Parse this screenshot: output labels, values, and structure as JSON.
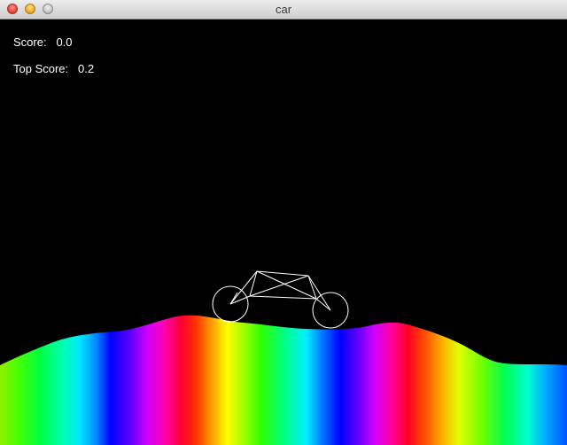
{
  "window": {
    "title": "car"
  },
  "hud": {
    "score_label": "Score:",
    "score_value": "0.0",
    "top_score_label": "Top Score:",
    "top_score_value": "0.2"
  },
  "colors": {
    "background": "#000000",
    "hud_text": "#ffffff",
    "car_lines": "#ffffff",
    "terrain": "rainbow-spectrum"
  }
}
